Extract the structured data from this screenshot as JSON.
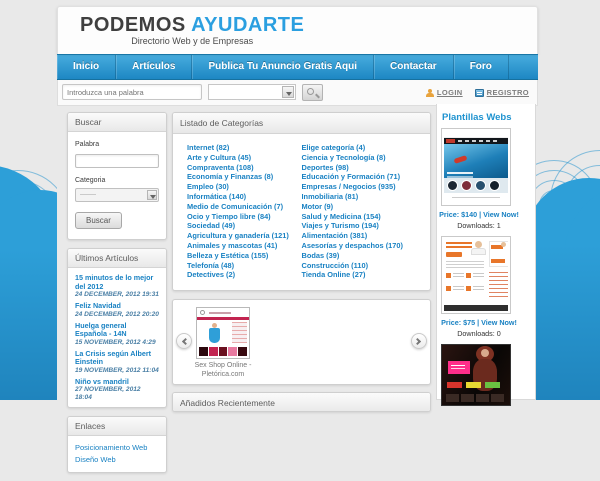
{
  "header": {
    "logo_primary": "PODEMOS",
    "logo_accent": "AYUDARTE",
    "tagline": "Directorio Web y de Empresas"
  },
  "nav": {
    "items": [
      {
        "label": "Inicio"
      },
      {
        "label": "Artículos"
      },
      {
        "label": "Publica Tu Anuncio Gratis Aqui"
      },
      {
        "label": "Contactar"
      },
      {
        "label": "Foro"
      }
    ]
  },
  "search": {
    "placeholder": "Introduzca una palabra",
    "login_label": "LOGIN",
    "register_label": "REGISTRO"
  },
  "sidebar": {
    "buscar": {
      "title": "Buscar",
      "word_label": "Palabra",
      "category_label": "Categoria",
      "category_value": "--------",
      "button_label": "Buscar"
    },
    "articulos": {
      "title": "Últimos Artículos",
      "items": [
        {
          "title": "15 minutos de lo mejor del 2012",
          "date": "24 DECEMBER, 2012 19:31"
        },
        {
          "title": "Feliz Navidad",
          "date": "24 DECEMBER, 2012 20:20"
        },
        {
          "title": "Huelga general Española - 14N",
          "date": "15 NOVEMBER, 2012 4:29"
        },
        {
          "title": "La Crisis según Albert Einstein",
          "date": "19 NOVEMBER, 2012 11:04"
        },
        {
          "title": "Niño vs mandril",
          "date": "27 NOVEMBER, 2012 18:04"
        }
      ]
    },
    "enlaces": {
      "title": "Enlaces",
      "items": [
        {
          "label": "Posicionamiento Web"
        },
        {
          "label": "Diseño Web"
        }
      ]
    }
  },
  "main": {
    "categories": {
      "title": "Listado de Categorías",
      "left": [
        "Internet (82)",
        "Arte y Cultura (45)",
        "Compraventa (108)",
        "Economía y Finanzas (8)",
        "Empleo (30)",
        "Informática (140)",
        "Medio de Comunicación (7)",
        "Ocio y Tiempo libre (84)",
        "Sociedad (49)",
        "Agricultura y ganadería (121)",
        "Animales y mascotas (41)",
        "Belleza y Estética (155)",
        "Telefonía (48)",
        "Detectives (2)"
      ],
      "right": [
        "Elige categoría (4)",
        "Ciencia y Tecnología (8)",
        "Deportes (98)",
        "Educación y Formación (71)",
        "Empresas / Negocios (935)",
        "Inmobiliaria (81)",
        "Motor (9)",
        "Salud y Medicina (154)",
        "Viajes y Turismo (194)",
        "Alimentación (381)",
        "Asesorías y despachos (170)",
        "Bodas (39)",
        "Construcción (110)",
        "Tienda Online (27)"
      ]
    },
    "carousel": {
      "caption_line1": "Sex Shop Online -",
      "caption_line2": "Pletórica.com"
    },
    "recent": {
      "title": "Añadidos Recientemente"
    }
  },
  "templates": {
    "title": "Plantillas Webs",
    "items": [
      {
        "price_line": "Price: $140 | View Now!",
        "downloads": "Downloads: 1"
      },
      {
        "price_line": "Price: $75 | View Now!",
        "downloads": "Downloads: 0"
      },
      {
        "price_line": "",
        "downloads": ""
      }
    ]
  },
  "colors": {
    "brand_blue": "#2d9fd8",
    "link_blue": "#1a82c3",
    "nav_gradient_top": "#47acde",
    "nav_gradient_bottom": "#1d87c3"
  }
}
